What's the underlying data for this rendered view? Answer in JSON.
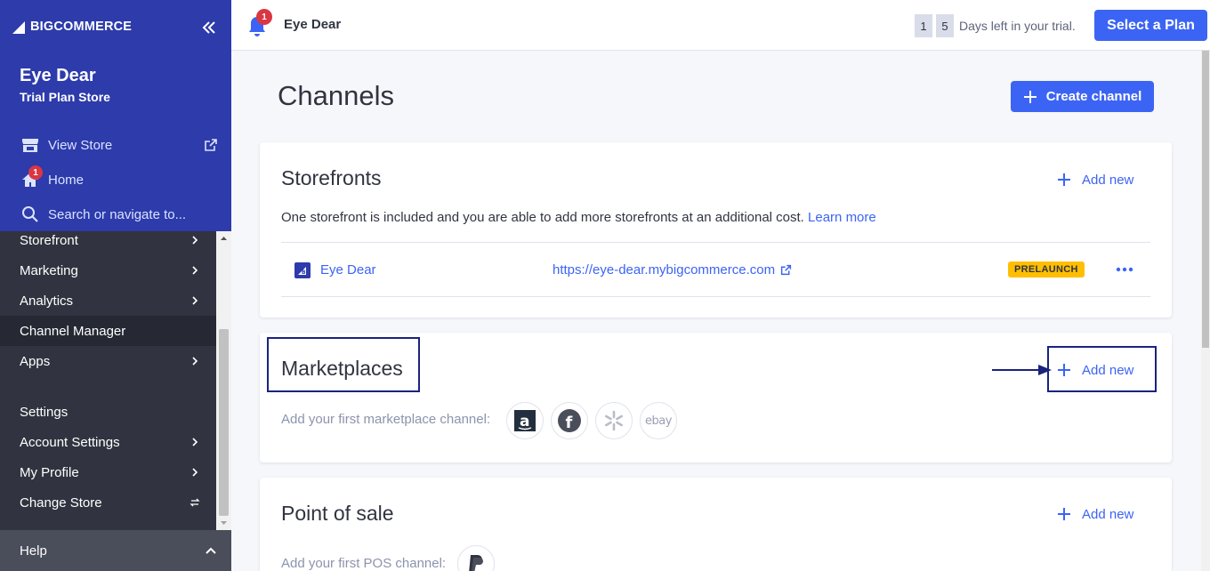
{
  "sidebar": {
    "logo_text": "BIGCOMMERCE",
    "logo_prefix": "BIG",
    "logo_suffix": "COMMERCE",
    "store_name": "Eye Dear",
    "store_plan": "Trial Plan Store",
    "links": {
      "view_store": "View Store",
      "home": "Home",
      "home_badge": "1",
      "search": "Search or navigate to..."
    },
    "nav_items": [
      {
        "label": "Storefront"
      },
      {
        "label": "Marketing"
      },
      {
        "label": "Analytics"
      },
      {
        "label": "Channel Manager"
      },
      {
        "label": "Apps"
      },
      {
        "label": "Settings"
      },
      {
        "label": "Account Settings"
      },
      {
        "label": "My Profile"
      },
      {
        "label": "Change Store"
      }
    ],
    "help": "Help"
  },
  "topbar": {
    "notification_badge": "1",
    "store_name": "Eye Dear",
    "trial_digits": [
      "1",
      "5"
    ],
    "trial_text": "Days left in your trial.",
    "select_plan": "Select a Plan"
  },
  "page": {
    "title": "Channels",
    "create_channel": "Create channel"
  },
  "storefronts": {
    "title": "Storefronts",
    "add_new": "Add new",
    "description": "One storefront is included and you are able to add more storefronts at an additional cost.",
    "learn_more": "Learn more",
    "rows": [
      {
        "name": "Eye Dear",
        "url": "https://eye-dear.mybigcommerce.com",
        "status": "PRELAUNCH"
      }
    ]
  },
  "marketplaces": {
    "title": "Marketplaces",
    "add_new": "Add new",
    "description": "Add your first marketplace channel:",
    "logos": [
      "amazon-logo",
      "facebook-logo",
      "walmart-logo",
      "ebay-logo"
    ],
    "ebay_text": "ebay"
  },
  "pos": {
    "title": "Point of sale",
    "add_new": "Add new",
    "description": "Add your first POS channel:"
  },
  "colors": {
    "sidebar_top": "#2d3bab",
    "sidebar_body": "#313440",
    "accent": "#3c64f4",
    "badge": "#db3643",
    "prelaunch": "#ffbf00",
    "annotation": "#1a237e"
  }
}
